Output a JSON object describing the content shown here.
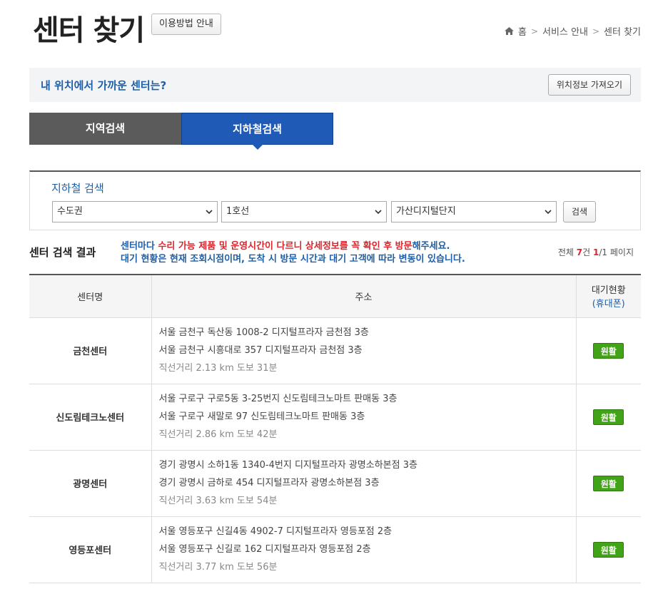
{
  "header": {
    "title": "센터 찾기",
    "guide_button": "이용방법 안내",
    "breadcrumb": [
      "홈",
      "서비스 안내",
      "센터 찾기"
    ]
  },
  "location": {
    "text": "내 위치에서 가까운 센터는?",
    "button": "위치정보 가져오기"
  },
  "tabs": [
    {
      "label": "지역검색",
      "active": false
    },
    {
      "label": "지하철검색",
      "active": true
    }
  ],
  "search": {
    "title": "지하철 검색",
    "region": "수도권",
    "line": "1호선",
    "station": "가산디지털단지",
    "button": "검색"
  },
  "results": {
    "title": "센터 검색 결과",
    "notice_line1_a": "센터마다 ",
    "notice_line1_b": "수리 가능 제품 및 운영시간이 다르니 상세정보를 꼭 확인 후 방문",
    "notice_line1_c": "해주세요.",
    "notice_line2": "대기 현황은 현재 조회시점이며, 도착 시 방문 시간과 대기 고객에 따라 변동이 있습니다.",
    "total_label": "전체 ",
    "total_count": "7",
    "total_unit": "건 ",
    "page_current": "1",
    "page_sep": "/1 페이지",
    "columns": {
      "name": "센터명",
      "address": "주소",
      "wait": "대기현황",
      "wait_sub": "(휴대폰)"
    },
    "rows": [
      {
        "name": "금천센터",
        "addr1": "서울 금천구 독산동 1008-2 디지털프라자 금천점 3층",
        "addr2": "서울 금천구 시흥대로 357 디지털프라자 금천점 3층",
        "dist": "직선거리 2.13 km 도보 31분",
        "status": "원활"
      },
      {
        "name": "신도림테크노센터",
        "addr1": "서울 구로구 구로5동 3-25번지 신도림테크노마트 판매동 3층",
        "addr2": "서울 구로구 새말로 97 신도림테크노마트 판매동 3층",
        "dist": "직선거리 2.86 km 도보 42분",
        "status": "원활"
      },
      {
        "name": "광명센터",
        "addr1": "경기 광명시 소하1동 1340-4번지 디지털프라자 광명소하본점 3층",
        "addr2": "경기 광명시 금하로 454 디지털프라자 광명소하본점 3층",
        "dist": "직선거리 3.63 km 도보 54분",
        "status": "원활"
      },
      {
        "name": "영등포센터",
        "addr1": "서울 영등포구 신길4동 4902-7 디지털프라자 영등포점 2층",
        "addr2": "서울 영등포구 신길로 162 디지털프라자 영등포점 2층",
        "dist": "직선거리 3.77 km 도보 56분",
        "status": "원활"
      }
    ]
  },
  "colors": {
    "accent": "#1f5fa8",
    "active_tab": "#1f5bb6",
    "status_ok": "#43a318",
    "notice_red": "#d9262c"
  }
}
